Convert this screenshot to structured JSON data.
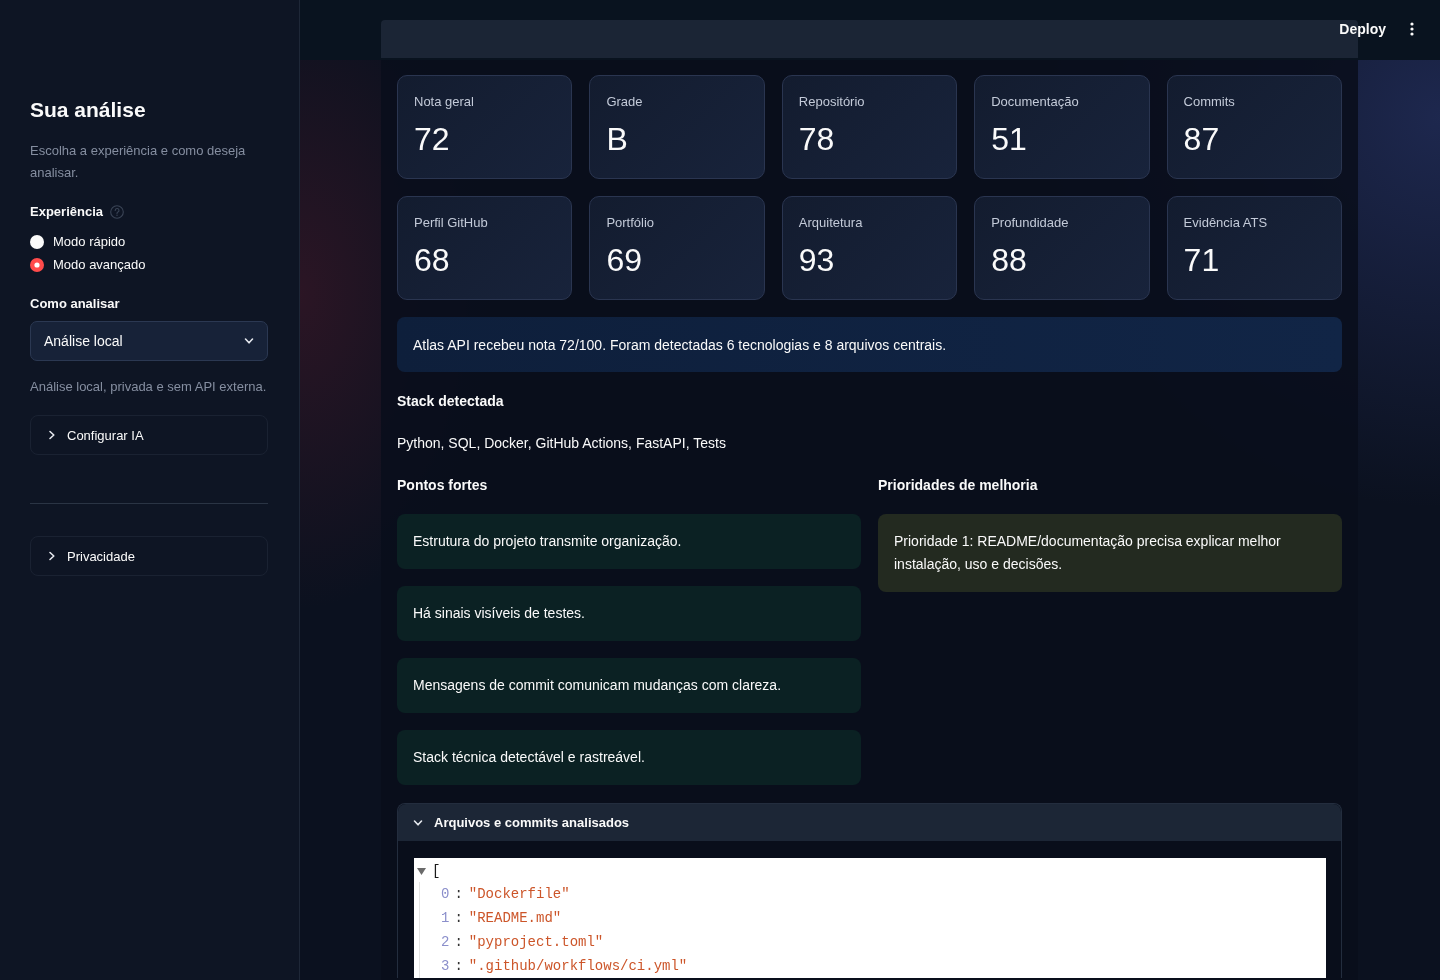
{
  "header": {
    "deploy_button": "Deploy"
  },
  "sidebar": {
    "title": "Sua análise",
    "caption": "Escolha a experiência e como deseja analisar.",
    "experience": {
      "label": "Experiência",
      "options": [
        {
          "label": "Modo rápido",
          "selected": false
        },
        {
          "label": "Modo avançado",
          "selected": true
        }
      ]
    },
    "analysis_mode": {
      "label": "Como analisar",
      "value": "Análise local",
      "caption": "Análise local, privada e sem API externa."
    },
    "ai_settings": {
      "label": "Configurar IA",
      "expanded": false
    },
    "privacy": {
      "label": "Privacidade",
      "expanded": false
    }
  },
  "metrics": [
    {
      "label": "Nota geral",
      "value": "72"
    },
    {
      "label": "Grade",
      "value": "B"
    },
    {
      "label": "Repositório",
      "value": "78"
    },
    {
      "label": "Documentação",
      "value": "51"
    },
    {
      "label": "Commits",
      "value": "87"
    },
    {
      "label": "Perfil GitHub",
      "value": "68"
    },
    {
      "label": "Portfólio",
      "value": "69"
    },
    {
      "label": "Arquitetura",
      "value": "93"
    },
    {
      "label": "Profundidade",
      "value": "88"
    },
    {
      "label": "Evidência ATS",
      "value": "71"
    }
  ],
  "summary": "Atlas API recebeu nota 72/100. Foram detectadas 6 tecnologias e 8 arquivos centrais.",
  "stack": {
    "heading": "Stack detectada",
    "text": "Python, SQL, Docker, GitHub Actions, FastAPI, Tests"
  },
  "strengths": {
    "heading": "Pontos fortes",
    "items": [
      "Estrutura do projeto transmite organização.",
      "Há sinais visíveis de testes.",
      "Mensagens de commit comunicam mudanças com clareza.",
      "Stack técnica detectável e rastreável."
    ]
  },
  "priorities": {
    "heading": "Prioridades de melhoria",
    "items": [
      "Prioridade 1: README/documentação precisa explicar melhor instalação, uso e decisões."
    ]
  },
  "files_expander": {
    "label": "Arquivos e commits analisados",
    "expanded": true,
    "json_tree": {
      "expanded": true,
      "open_bracket": "[",
      "entries": [
        {
          "index": "0",
          "separator": ":",
          "value": "\"Dockerfile\""
        },
        {
          "index": "1",
          "separator": ":",
          "value": "\"README.md\""
        },
        {
          "index": "2",
          "separator": ":",
          "value": "\"pyproject.toml\""
        },
        {
          "index": "3",
          "separator": ":",
          "value": "\".github/workflows/ci.yml\""
        }
      ]
    }
  }
}
